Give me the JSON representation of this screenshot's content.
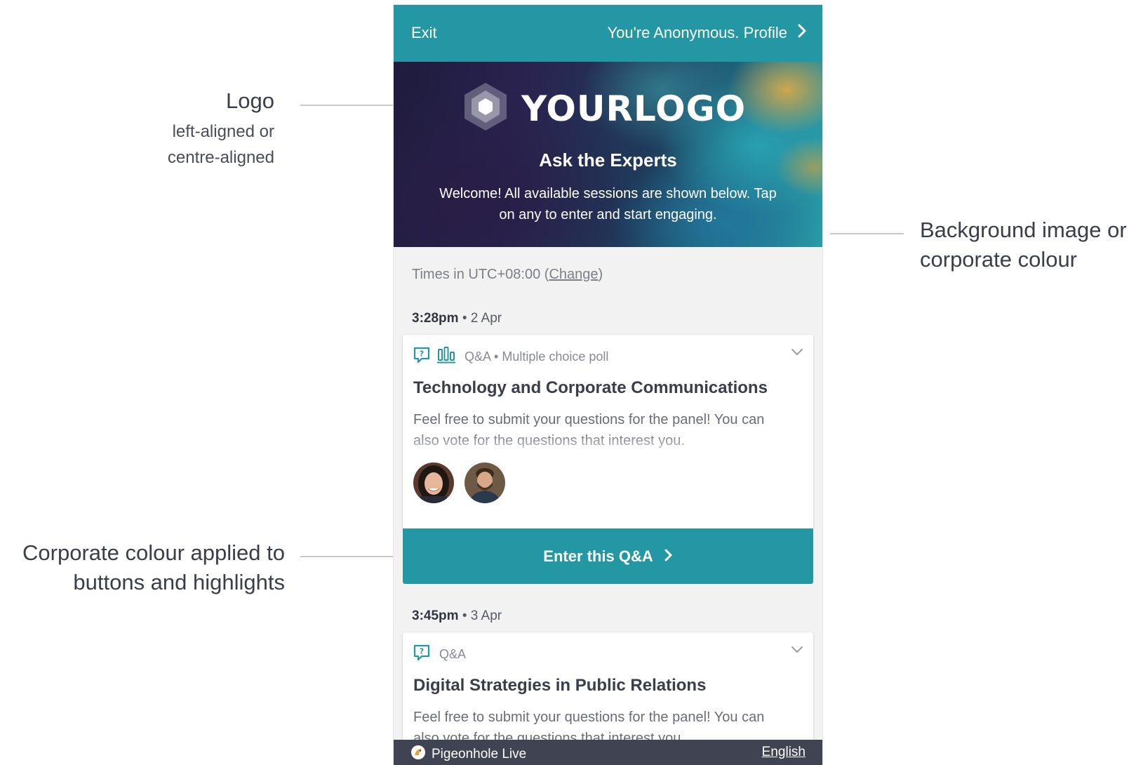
{
  "annotations": {
    "logo": {
      "title": "Logo",
      "subtitle_line1": "left-aligned or",
      "subtitle_line2": "centre-aligned"
    },
    "background": {
      "line1": "Background image or",
      "line2": "corporate colour"
    },
    "corporate": {
      "line1": "Corporate colour applied to",
      "line2": "buttons and highlights"
    }
  },
  "topbar": {
    "exit_label": "Exit",
    "profile_label": "You're Anonymous. Profile",
    "profile_icon": "chevron-right-icon"
  },
  "hero": {
    "logo_text": "YOURLOGO",
    "logo_icon": "hexagon-logo-icon",
    "title": "Ask the Experts",
    "welcome_line1": "Welcome! All available sessions are shown below. Tap",
    "welcome_line2": "on any to enter and start engaging."
  },
  "timezone": {
    "prefix": "Times in UTC+08:00 (",
    "change_link": "Change",
    "suffix": ")"
  },
  "sessions": [
    {
      "time": "3:28pm",
      "separator": "•",
      "date": "2 Apr",
      "types": "Q&A • Multiple choice poll",
      "icons": [
        "qa-icon",
        "poll-icon"
      ],
      "title": "Technology and Corporate Communications",
      "description": "Feel free to submit your questions for the panel! You can also vote for the questions that interest you.",
      "speakers": [
        "speaker-avatar-1",
        "speaker-avatar-2"
      ],
      "button_label": "Enter this Q&A"
    },
    {
      "time": "3:45pm",
      "separator": "•",
      "date": "3 Apr",
      "types": "Q&A",
      "icons": [
        "qa-icon"
      ],
      "title": "Digital Strategies in Public Relations",
      "description": "Feel free to submit your questions for the panel! You can also vote for the questions that interest you."
    }
  ],
  "footer": {
    "brand": "Pigeonhole Live",
    "brand_icon": "pigeonhole-logo-icon",
    "language": "English"
  },
  "colors": {
    "corporate": "#2397a3",
    "footer": "#404452",
    "page_background": "#f2f2f2"
  }
}
